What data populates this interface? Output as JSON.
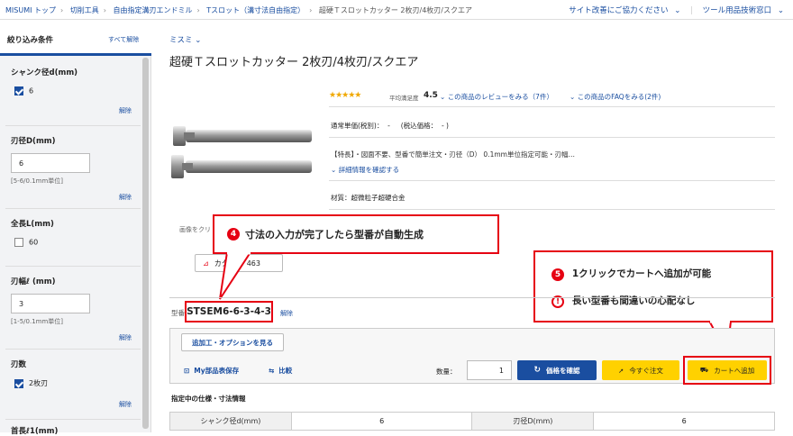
{
  "breadcrumb": [
    "MISUMI トップ",
    "切削工具",
    "自由指定溝刃エンドミル",
    "Tスロット（溝寸法自由指定）",
    "超硬Ｔスロットカッター 2枚刃/4枚刃/スクエア"
  ],
  "topright": {
    "link1": "サイト改善にご協力ください",
    "link2": "ツール用品技術窓口"
  },
  "sidebar": {
    "title": "絞り込み条件",
    "clear_all": "すべて解除",
    "sections": [
      {
        "title": "シャンク径d(mm)",
        "checkbox_label": "6",
        "checked": true,
        "clear": "解除"
      },
      {
        "title": "刃径D(mm)",
        "input_value": "6",
        "note": "[5-6/0.1mm単位]",
        "clear": "解除"
      },
      {
        "title": "全長L(mm)",
        "checkbox_label": "60",
        "checked": false
      },
      {
        "title": "刃幅ℓ (mm)",
        "input_value": "3",
        "note": "[1-5/0.1mm単位]",
        "clear": "解除"
      },
      {
        "title": "刃数",
        "checkbox_label": "2枚刃",
        "checked": true,
        "clear": "解除"
      },
      {
        "title": "首長ℓ1(mm)"
      }
    ]
  },
  "brand": "ミスミ",
  "product_title": "超硬Ｔスロットカッター 2枚刃/4枚刃/スクエア",
  "rating": {
    "stars": "★★★★★",
    "label": "平均満足度",
    "value": "4.5",
    "reviews_link": "この商品のレビューをみる（7件）",
    "faq_link": "この商品のFAQをみる(2件)"
  },
  "price_line": "通常単価(税別)：  -     (税込価格：  - )",
  "feature": "【特長】・図面不要、型番で簡単注文・刃径（D） 0.1mm単位指定可能・刃幅…",
  "detail_link": "詳細情報を確認する",
  "material": "材質：超微粒子超硬合金",
  "image_note": "画像をクリ",
  "catalog": {
    "label": "カタログ",
    "pages": "463"
  },
  "callout4": {
    "badge": "4",
    "text": "寸法の入力が完了したら型番が自動生成"
  },
  "callout5": {
    "badge": "5",
    "text": "1クリックでカートへ追加が可能",
    "badge2": "!",
    "text2": "長い型番も間違いの心配なし"
  },
  "part_number": {
    "label": "型番",
    "value": "STSEM6-6-3-4-3",
    "clear": "解除"
  },
  "options_button": "追加工・オプションを見る",
  "actions": {
    "my_parts": "My部品表保存",
    "compare": "比較",
    "qty_label": "数量：",
    "qty_value": "1",
    "check_price": "価格を確認",
    "order_now": "今すぐ注文",
    "add_cart": "カートへ追加"
  },
  "spec_heading": "指定中の仕様・寸法情報",
  "spec_table": {
    "c1": "シャンク径d(mm)",
    "v1": "6",
    "c2": "刃径D(mm)",
    "v2": "6"
  },
  "colors": {
    "accent": "#1a4ea0",
    "callout": "#e60012",
    "cart_yellow": "#ffd100"
  }
}
